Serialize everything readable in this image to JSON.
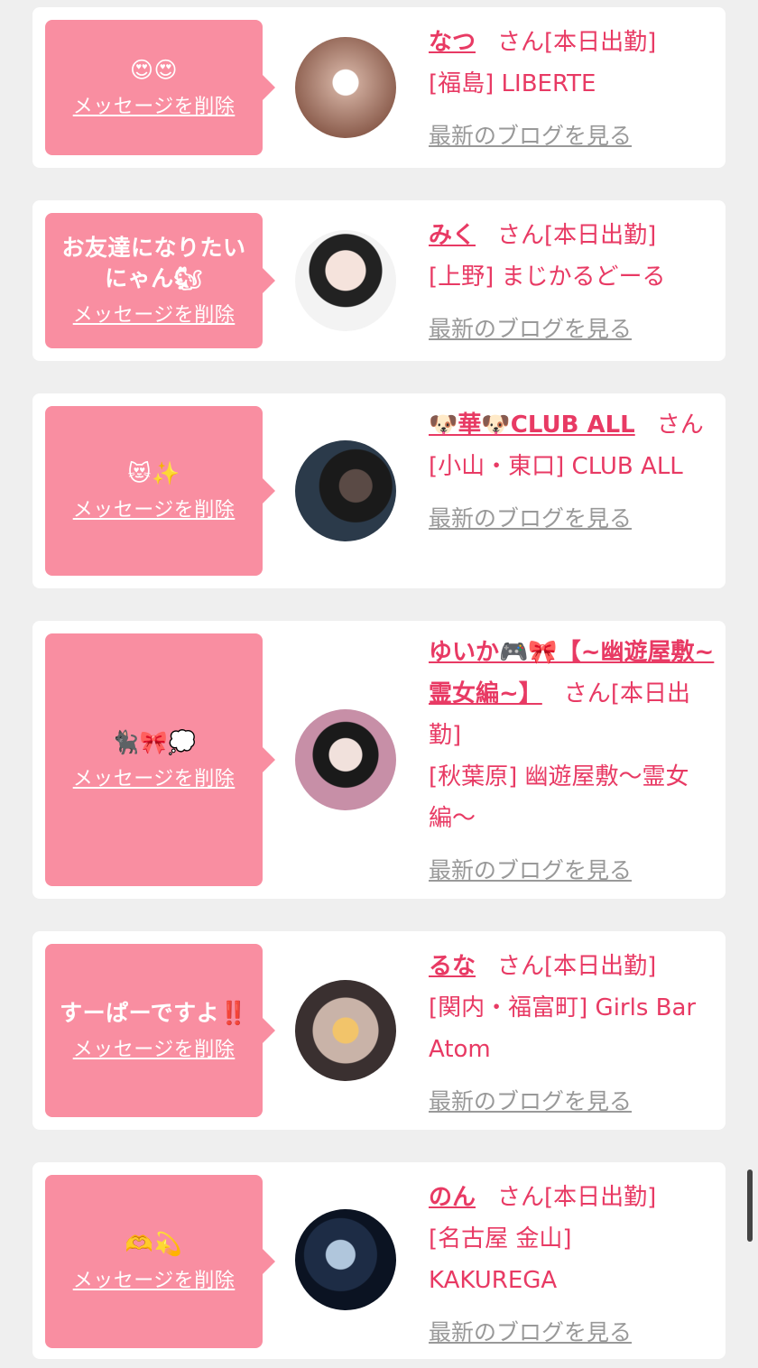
{
  "delete_label": "メッセージを削除",
  "san_label": "さん",
  "blog_label": "最新のブログを見る",
  "colors": {
    "accent": "#e83a64",
    "bubble": "#f98ea1",
    "background": "#efefef"
  },
  "cards": [
    {
      "message": "😍😍",
      "name": "なつ",
      "status": "[本日出勤]",
      "location": "[福島] LIBERTE"
    },
    {
      "message": "お友達になりたいにゃん🐿",
      "name": "みく",
      "status": "[本日出勤]",
      "location": "[上野] まじかるどーる"
    },
    {
      "message": "😻✨",
      "name": "🐶華🐶CLUB ALL",
      "status": "",
      "location": "[小山・東口] CLUB ALL"
    },
    {
      "message": "🐈‍⬛🎀💭",
      "name": "ゆいか🎮🎀【~幽遊屋敷~霊女編~】",
      "status": "[本日出勤]",
      "location": "[秋葉原] 幽遊屋敷〜霊女編〜"
    },
    {
      "message": "すーぱーですよ‼️",
      "name": "るな",
      "status": "[本日出勤]",
      "location": "[関内・福富町] Girls Bar Atom"
    },
    {
      "message": "🫶💫",
      "name": "のん",
      "status": "[本日出勤]",
      "location": "[名古屋 金山] KAKUREGA"
    }
  ]
}
